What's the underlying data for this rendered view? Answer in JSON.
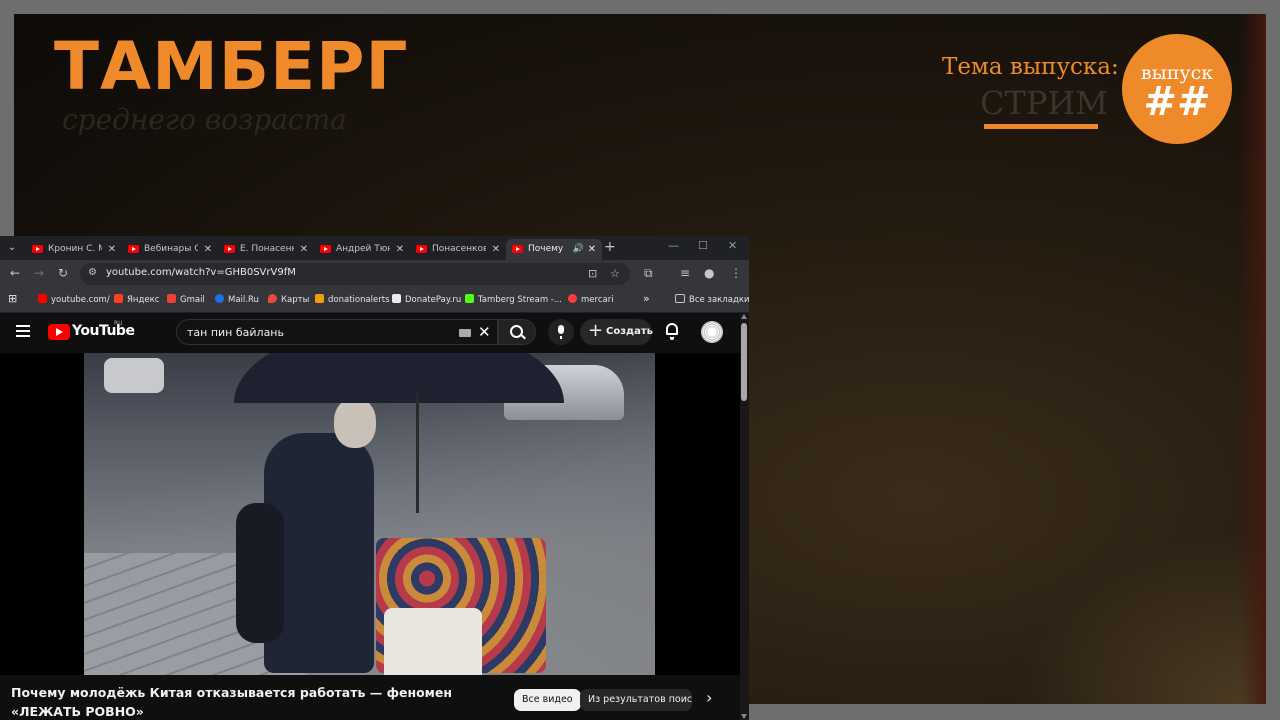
{
  "overlay": {
    "logo_title": "ТАМБЕРГ",
    "logo_subtitle": "среднего возраста",
    "theme_label": "Тема выпуска:",
    "theme_value": "СТРИМ",
    "badge_top": "выпуск",
    "badge_number": "##"
  },
  "browser": {
    "tabs": [
      {
        "label": "Кронин С. М"
      },
      {
        "label": "Вебинары С"
      },
      {
        "label": "Е. Понасенк"
      },
      {
        "label": "Андрей Тюн"
      },
      {
        "label": "Понасенков"
      },
      {
        "label": "Почему"
      }
    ],
    "url": "youtube.com/watch?v=GHB0SVrV9fM",
    "bookmarks": [
      {
        "label": "youtube.com/",
        "color": "#ff0000"
      },
      {
        "label": "Яндекс",
        "color": "#fc3f1d"
      },
      {
        "label": "Gmail",
        "color": "#ea4335"
      },
      {
        "label": "Mail.Ru",
        "color": "#1a73e8"
      },
      {
        "label": "Карты",
        "color": "#e84b3c"
      },
      {
        "label": "donationalerts",
        "color": "#f59c07"
      },
      {
        "label": "DonatePay.ru",
        "color": "#e8eaed"
      },
      {
        "label": "Tamberg Stream -...",
        "color": "#53fc18"
      },
      {
        "label": "mercari",
        "color": "#ff3c3c"
      }
    ],
    "bookmarks_more": "»",
    "all_bookmarks": "Все закладки"
  },
  "youtube": {
    "wordmark": "YouTube",
    "country": "RU",
    "search_query": "тан пин байлань",
    "create_label": "Создать",
    "video_title": "Почему молодёжь Китая отказывается работать — феномен «ЛЕЖАТЬ РОВНО»",
    "chips": [
      "Все видео",
      "Из результатов поиска"
    ]
  }
}
